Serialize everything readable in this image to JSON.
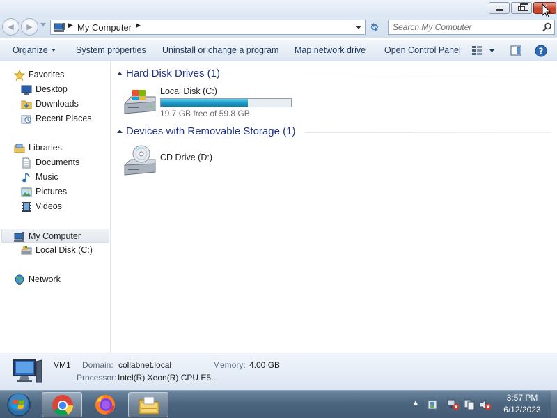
{
  "window": {
    "minimize_label": "Minimize",
    "maximize_label": "Restore Down",
    "close_label": "Close"
  },
  "address_bar": {
    "path": [
      "My Computer"
    ],
    "search_placeholder": "Search My Computer"
  },
  "toolbar": {
    "organize": "Organize",
    "system_properties": "System properties",
    "uninstall": "Uninstall or change a program",
    "map_drive": "Map network drive",
    "control_panel": "Open Control Panel"
  },
  "nav": {
    "favorites": {
      "label": "Favorites",
      "items": [
        "Desktop",
        "Downloads",
        "Recent Places"
      ]
    },
    "libraries": {
      "label": "Libraries",
      "items": [
        "Documents",
        "Music",
        "Pictures",
        "Videos"
      ]
    },
    "computer": {
      "label": "My Computer",
      "items": [
        "Local Disk (C:)"
      ]
    },
    "network": {
      "label": "Network"
    }
  },
  "content": {
    "groups": [
      {
        "title": "Hard Disk Drives (1)",
        "drives": [
          {
            "name": "Local Disk (C:)",
            "free_text": "19.7 GB free of 59.8 GB",
            "used_fraction": 0.67
          }
        ]
      },
      {
        "title": "Devices with Removable Storage (1)",
        "drives": [
          {
            "name": "CD Drive (D:)"
          }
        ]
      }
    ]
  },
  "details": {
    "computer_name": "VM1",
    "domain_label": "Domain:",
    "domain_value": "collabnet.local",
    "memory_label": "Memory:",
    "memory_value": "4.00 GB",
    "processor_label": "Processor:",
    "processor_value": "Intel(R) Xeon(R) CPU E5..."
  },
  "taskbar": {
    "apps": [
      "Google Chrome",
      "Firefox",
      "Windows Explorer"
    ],
    "time": "3:57 PM",
    "date": "6/12/2023"
  },
  "icons": {
    "favorites": "star-icon",
    "desktop": "desktop-icon",
    "downloads": "downloads-folder-icon",
    "recent_places": "recent-places-icon",
    "libraries": "libraries-icon",
    "documents": "documents-icon",
    "music": "music-note-icon",
    "pictures": "pictures-icon",
    "videos": "video-film-icon",
    "computer": "computer-icon",
    "local_disk": "hard-disk-icon",
    "network": "network-icon",
    "cd_drive": "cd-drive-icon"
  },
  "colors": {
    "group_header": "#1e3287",
    "disk_bar": "#26a0da",
    "close_button": "#c8432b"
  }
}
